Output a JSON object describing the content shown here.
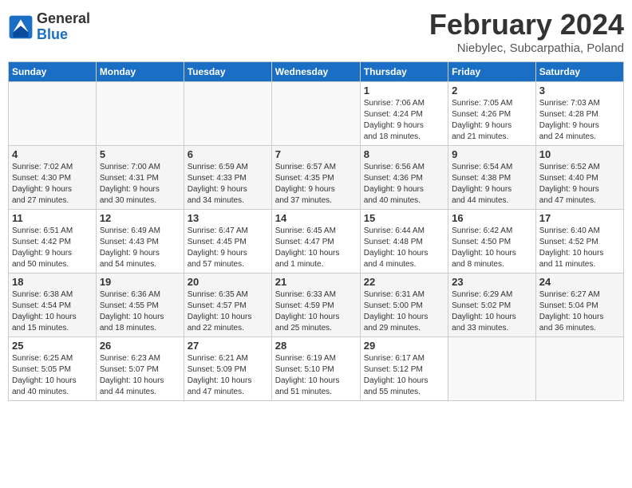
{
  "header": {
    "logo_general": "General",
    "logo_blue": "Blue",
    "title": "February 2024",
    "subtitle": "Niebylec, Subcarpathia, Poland"
  },
  "days_of_week": [
    "Sunday",
    "Monday",
    "Tuesday",
    "Wednesday",
    "Thursday",
    "Friday",
    "Saturday"
  ],
  "weeks": [
    [
      {
        "day": "",
        "info": ""
      },
      {
        "day": "",
        "info": ""
      },
      {
        "day": "",
        "info": ""
      },
      {
        "day": "",
        "info": ""
      },
      {
        "day": "1",
        "info": "Sunrise: 7:06 AM\nSunset: 4:24 PM\nDaylight: 9 hours\nand 18 minutes."
      },
      {
        "day": "2",
        "info": "Sunrise: 7:05 AM\nSunset: 4:26 PM\nDaylight: 9 hours\nand 21 minutes."
      },
      {
        "day": "3",
        "info": "Sunrise: 7:03 AM\nSunset: 4:28 PM\nDaylight: 9 hours\nand 24 minutes."
      }
    ],
    [
      {
        "day": "4",
        "info": "Sunrise: 7:02 AM\nSunset: 4:30 PM\nDaylight: 9 hours\nand 27 minutes."
      },
      {
        "day": "5",
        "info": "Sunrise: 7:00 AM\nSunset: 4:31 PM\nDaylight: 9 hours\nand 30 minutes."
      },
      {
        "day": "6",
        "info": "Sunrise: 6:59 AM\nSunset: 4:33 PM\nDaylight: 9 hours\nand 34 minutes."
      },
      {
        "day": "7",
        "info": "Sunrise: 6:57 AM\nSunset: 4:35 PM\nDaylight: 9 hours\nand 37 minutes."
      },
      {
        "day": "8",
        "info": "Sunrise: 6:56 AM\nSunset: 4:36 PM\nDaylight: 9 hours\nand 40 minutes."
      },
      {
        "day": "9",
        "info": "Sunrise: 6:54 AM\nSunset: 4:38 PM\nDaylight: 9 hours\nand 44 minutes."
      },
      {
        "day": "10",
        "info": "Sunrise: 6:52 AM\nSunset: 4:40 PM\nDaylight: 9 hours\nand 47 minutes."
      }
    ],
    [
      {
        "day": "11",
        "info": "Sunrise: 6:51 AM\nSunset: 4:42 PM\nDaylight: 9 hours\nand 50 minutes."
      },
      {
        "day": "12",
        "info": "Sunrise: 6:49 AM\nSunset: 4:43 PM\nDaylight: 9 hours\nand 54 minutes."
      },
      {
        "day": "13",
        "info": "Sunrise: 6:47 AM\nSunset: 4:45 PM\nDaylight: 9 hours\nand 57 minutes."
      },
      {
        "day": "14",
        "info": "Sunrise: 6:45 AM\nSunset: 4:47 PM\nDaylight: 10 hours\nand 1 minute."
      },
      {
        "day": "15",
        "info": "Sunrise: 6:44 AM\nSunset: 4:48 PM\nDaylight: 10 hours\nand 4 minutes."
      },
      {
        "day": "16",
        "info": "Sunrise: 6:42 AM\nSunset: 4:50 PM\nDaylight: 10 hours\nand 8 minutes."
      },
      {
        "day": "17",
        "info": "Sunrise: 6:40 AM\nSunset: 4:52 PM\nDaylight: 10 hours\nand 11 minutes."
      }
    ],
    [
      {
        "day": "18",
        "info": "Sunrise: 6:38 AM\nSunset: 4:54 PM\nDaylight: 10 hours\nand 15 minutes."
      },
      {
        "day": "19",
        "info": "Sunrise: 6:36 AM\nSunset: 4:55 PM\nDaylight: 10 hours\nand 18 minutes."
      },
      {
        "day": "20",
        "info": "Sunrise: 6:35 AM\nSunset: 4:57 PM\nDaylight: 10 hours\nand 22 minutes."
      },
      {
        "day": "21",
        "info": "Sunrise: 6:33 AM\nSunset: 4:59 PM\nDaylight: 10 hours\nand 25 minutes."
      },
      {
        "day": "22",
        "info": "Sunrise: 6:31 AM\nSunset: 5:00 PM\nDaylight: 10 hours\nand 29 minutes."
      },
      {
        "day": "23",
        "info": "Sunrise: 6:29 AM\nSunset: 5:02 PM\nDaylight: 10 hours\nand 33 minutes."
      },
      {
        "day": "24",
        "info": "Sunrise: 6:27 AM\nSunset: 5:04 PM\nDaylight: 10 hours\nand 36 minutes."
      }
    ],
    [
      {
        "day": "25",
        "info": "Sunrise: 6:25 AM\nSunset: 5:05 PM\nDaylight: 10 hours\nand 40 minutes."
      },
      {
        "day": "26",
        "info": "Sunrise: 6:23 AM\nSunset: 5:07 PM\nDaylight: 10 hours\nand 44 minutes."
      },
      {
        "day": "27",
        "info": "Sunrise: 6:21 AM\nSunset: 5:09 PM\nDaylight: 10 hours\nand 47 minutes."
      },
      {
        "day": "28",
        "info": "Sunrise: 6:19 AM\nSunset: 5:10 PM\nDaylight: 10 hours\nand 51 minutes."
      },
      {
        "day": "29",
        "info": "Sunrise: 6:17 AM\nSunset: 5:12 PM\nDaylight: 10 hours\nand 55 minutes."
      },
      {
        "day": "",
        "info": ""
      },
      {
        "day": "",
        "info": ""
      }
    ]
  ]
}
